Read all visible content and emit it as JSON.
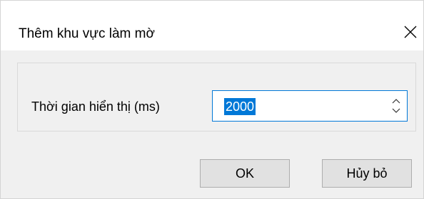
{
  "dialog": {
    "title": "Thêm khu vực làm mờ",
    "close_icon": "close-icon"
  },
  "form": {
    "duration_label": "Thời gian hiển thị (ms)",
    "duration_value": "2000",
    "spin_icons": [
      "chevron-up-icon",
      "chevron-down-icon"
    ]
  },
  "buttons": {
    "ok_label": "OK",
    "cancel_label": "Hủy bỏ"
  },
  "colors": {
    "accent": "#0078d7",
    "dialog_bg": "#f0f0f0",
    "button_bg": "#e1e1e1"
  }
}
